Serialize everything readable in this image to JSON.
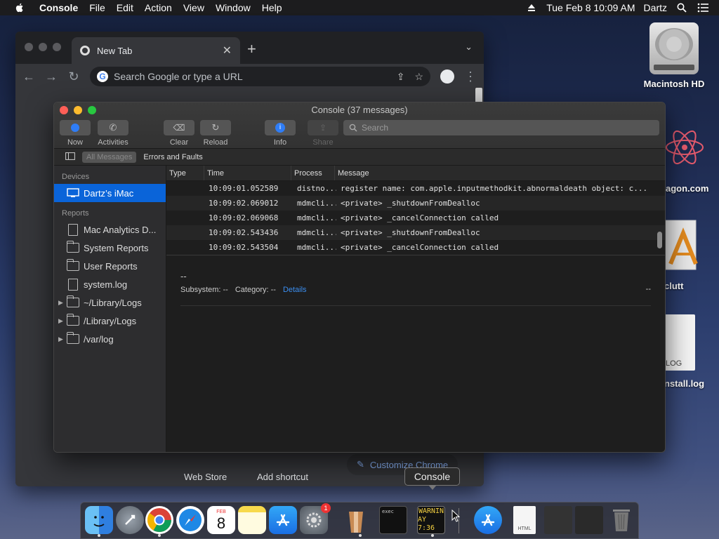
{
  "menubar": {
    "app": "Console",
    "items": [
      "File",
      "Edit",
      "Action",
      "View",
      "Window",
      "Help"
    ],
    "datetime": "Tue Feb 8  10:09 AM",
    "user": "Dartz"
  },
  "desktop": {
    "hd_label": "Macintosh HD",
    "partial_labels": [
      "agon.com",
      "clutt",
      "nstall.log"
    ],
    "log_doc_label": "LOG"
  },
  "chrome": {
    "tab_title": "New Tab",
    "omnibox_placeholder": "Search Google or type a URL",
    "ntp_web_store": "Web Store",
    "ntp_add_shortcut": "Add shortcut",
    "customize": "Customize Chrome"
  },
  "console": {
    "title": "Console (37 messages)",
    "toolbar": {
      "now": "Now",
      "activities": "Activities",
      "clear": "Clear",
      "reload": "Reload",
      "info": "Info",
      "share": "Share"
    },
    "search_placeholder": "Search",
    "filters": {
      "all": "All Messages",
      "errors": "Errors and Faults"
    },
    "sidebar": {
      "devices_header": "Devices",
      "device": "Dartz’s iMac",
      "reports_header": "Reports",
      "reports": [
        {
          "label": "Mac Analytics D...",
          "kind": "doc"
        },
        {
          "label": "System Reports",
          "kind": "folder"
        },
        {
          "label": "User Reports",
          "kind": "folder"
        },
        {
          "label": "system.log",
          "kind": "doc"
        },
        {
          "label": "~/Library/Logs",
          "kind": "folder-expand"
        },
        {
          "label": "/Library/Logs",
          "kind": "folder-expand"
        },
        {
          "label": "/var/log",
          "kind": "folder-expand"
        }
      ]
    },
    "columns": {
      "type": "Type",
      "time": "Time",
      "process": "Process",
      "message": "Message"
    },
    "rows": [
      {
        "time": "10:09:01.052589",
        "process": "distno...",
        "message": "register name: com.apple.inputmethodkit.abnormaldeath object: c..."
      },
      {
        "time": "10:09:02.069012",
        "process": "mdmcli...",
        "message": "<private> _shutdownFromDealloc"
      },
      {
        "time": "10:09:02.069068",
        "process": "mdmcli...",
        "message": "<private> _cancelConnection called"
      },
      {
        "time": "10:09:02.543436",
        "process": "mdmcli...",
        "message": "<private> _shutdownFromDealloc"
      },
      {
        "time": "10:09:02.543504",
        "process": "mdmcli...",
        "message": "<private> _cancelConnection called"
      }
    ],
    "detail": {
      "dash": "--",
      "subsystem": "Subsystem: --",
      "category": "Category: --",
      "details_link": "Details",
      "right_dash": "--"
    }
  },
  "tooltip": "Console",
  "dock": {
    "terminal_text": "exec",
    "console_text_1": "WARNIN",
    "console_text_2": "AY 7:36",
    "calendar_month": "FEB",
    "calendar_day": "8",
    "sysprefs_badge": "1",
    "html_label": "HTML"
  },
  "colors": {
    "accent": "#0a64d9",
    "link": "#3b8ef0",
    "console_warn": "#f5d142"
  }
}
